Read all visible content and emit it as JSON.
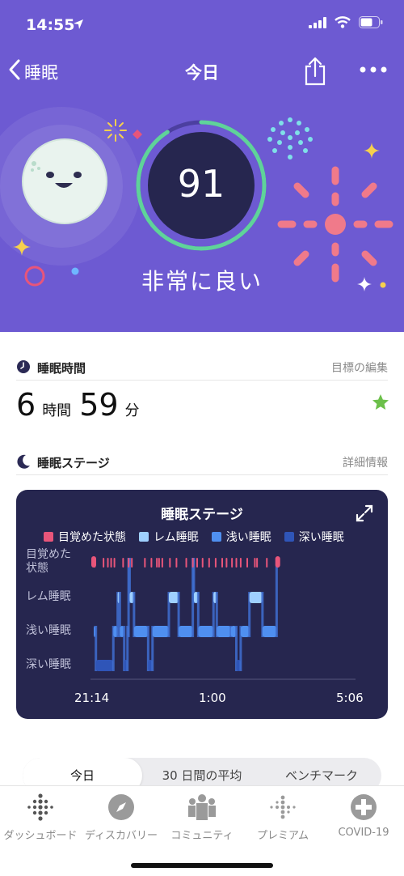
{
  "status_bar": {
    "time": "14:55"
  },
  "nav": {
    "back_label": "睡眠",
    "title": "今日"
  },
  "score": {
    "value": "91",
    "label": "非常に良い",
    "progress": 0.91
  },
  "duration_section": {
    "title": "睡眠時間",
    "link": "目標の編集",
    "hours": "6",
    "hours_unit": "時間",
    "minutes": "59",
    "minutes_unit": "分"
  },
  "stages_section": {
    "title": "睡眠ステージ",
    "link": "詳細情報"
  },
  "colors": {
    "hero": "#6d5ad2",
    "ring": "#5fd39a",
    "awake": "#e8557a",
    "rem": "#9fd0ff",
    "light": "#4f8ff0",
    "deep": "#2f55b8"
  },
  "chart_data": {
    "type": "hypnogram",
    "title": "睡眠ステージ",
    "legend": [
      "目覚めた状態",
      "レム睡眠",
      "浅い睡眠",
      "深い睡眠"
    ],
    "y_levels": [
      "目覚めた\n状態",
      "レム睡眠",
      "浅い睡眠",
      "深い睡眠"
    ],
    "x_ticks": [
      "21:14",
      "1:00",
      "5:06"
    ],
    "x_range_min": [
      0,
      472
    ],
    "segments": [
      {
        "stage": "light",
        "start": 0,
        "end": 4
      },
      {
        "stage": "deep",
        "start": 4,
        "end": 36
      },
      {
        "stage": "light",
        "start": 36,
        "end": 44
      },
      {
        "stage": "rem",
        "start": 44,
        "end": 48
      },
      {
        "stage": "light",
        "start": 48,
        "end": 56
      },
      {
        "stage": "deep",
        "start": 56,
        "end": 62
      },
      {
        "stage": "light",
        "start": 62,
        "end": 64
      },
      {
        "stage": "awake",
        "start": 64,
        "end": 66
      },
      {
        "stage": "rem",
        "start": 66,
        "end": 74
      },
      {
        "stage": "light",
        "start": 74,
        "end": 100
      },
      {
        "stage": "deep",
        "start": 100,
        "end": 108
      },
      {
        "stage": "light",
        "start": 108,
        "end": 138
      },
      {
        "stage": "rem",
        "start": 138,
        "end": 156
      },
      {
        "stage": "light",
        "start": 156,
        "end": 182
      },
      {
        "stage": "awake",
        "start": 182,
        "end": 184
      },
      {
        "stage": "rem",
        "start": 184,
        "end": 192
      },
      {
        "stage": "light",
        "start": 192,
        "end": 220
      },
      {
        "stage": "rem",
        "start": 220,
        "end": 226
      },
      {
        "stage": "light",
        "start": 226,
        "end": 252
      },
      {
        "stage": "light",
        "start": 252,
        "end": 262
      },
      {
        "stage": "deep",
        "start": 262,
        "end": 270
      },
      {
        "stage": "light",
        "start": 270,
        "end": 286
      },
      {
        "stage": "rem",
        "start": 286,
        "end": 310
      },
      {
        "stage": "light",
        "start": 310,
        "end": 336
      },
      {
        "stage": "awake",
        "start": 336,
        "end": 338
      }
    ],
    "awake_ticks": [
      2,
      18,
      26,
      32,
      38,
      54,
      64,
      70,
      94,
      106,
      116,
      120,
      126,
      140,
      152,
      170,
      182,
      190,
      200,
      212,
      224,
      236,
      244,
      254,
      262,
      270,
      282,
      296,
      300,
      318,
      338
    ]
  },
  "segmented": {
    "items": [
      "今日",
      "30 日間の平均",
      "ベンチマーク"
    ],
    "active": 0
  },
  "tabs": [
    {
      "label": "ダッシュボード",
      "icon": "dashboard-dots-icon"
    },
    {
      "label": "ディスカバリー",
      "icon": "compass-icon"
    },
    {
      "label": "コミュニティ",
      "icon": "community-people-icon"
    },
    {
      "label": "プレミアム",
      "icon": "premium-dots-icon"
    },
    {
      "label": "COVID-19",
      "icon": "plus-circle-icon"
    }
  ]
}
